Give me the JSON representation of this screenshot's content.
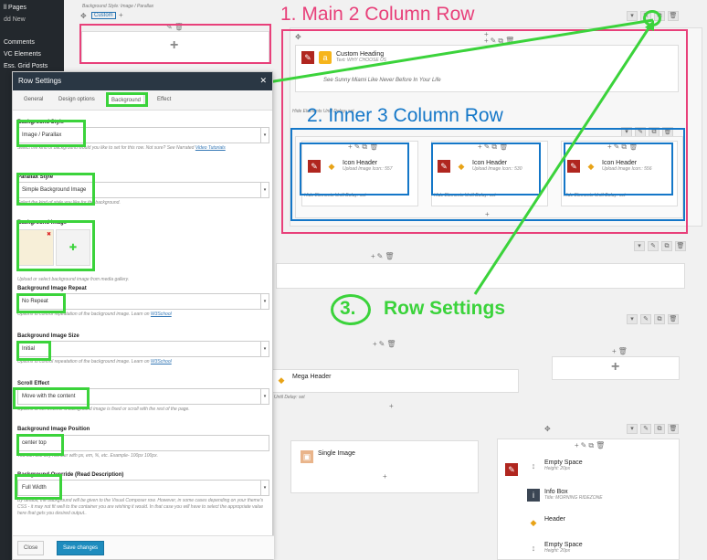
{
  "wp_menu": [
    "ll Pages",
    "dd New",
    "Comments",
    "VC Elements",
    "Ess. Grid Posts"
  ],
  "builder": {
    "top_note": "Background Style: Image / Parallax",
    "custom_tab": "Custom",
    "heading_title": "Custom Heading",
    "heading_sub": "Text: WHY CHOOSE US",
    "heading_text": "See Sunny Miami Like Never Before In Your Life",
    "hide_note": "Hide Elements Until Delay: set",
    "hide_note_short": "Until Delay: set",
    "icon_title": "Icon Header",
    "icons": [
      "Upload Image Icon:: 557",
      "Upload Image Icon:: 530",
      "Upload Image Icon:: 556"
    ],
    "mega_header": "Mega Header",
    "single_image": "Single Image",
    "right_items": [
      {
        "title": "Empty Space",
        "sub": "Height: 20px"
      },
      {
        "title": "Info Box",
        "sub": "Title: MORNING RIDEZONE"
      },
      {
        "title": "Header",
        "sub": ""
      },
      {
        "title": "Empty Space",
        "sub": "Height: 20px"
      }
    ]
  },
  "annotations": {
    "a1": "1. Main 2 Column Row",
    "a2": "2. Inner 3 Column Row",
    "a3_num": "3.",
    "a3": "Row Settings",
    "colors": {
      "pink": "#e8407a",
      "blue": "#1477c8",
      "green": "#3bd33b"
    }
  },
  "modal": {
    "title": "Row Settings",
    "tabs": [
      "General",
      "Design options",
      "Background",
      "Effect"
    ],
    "bg_style_label": "Background Style",
    "bg_style_value": "Image / Parallax",
    "bg_style_desc": "Select the kind of background would you like to set for this row. Not sure? See Narrated",
    "bg_style_link": "Video Tutorials",
    "parallax_label": "Parallax Style",
    "parallax_value": "Simple Background Image",
    "parallax_desc": "Select the kind of style you like for the background.",
    "bg_image_label": "Background Image",
    "bg_image_desc": "Upload or select background image from media gallery.",
    "repeat_label": "Background Image Repeat",
    "repeat_value": "No Repeat",
    "repeat_desc": "Options to control repeatation of the background image. Learn on",
    "repeat_link": "W3School",
    "size_label": "Background Image Size",
    "size_value": "Initial",
    "size_desc": "Options to control repeatation of the background image. Learn on",
    "size_link": "W3School",
    "scroll_label": "Scroll Effect",
    "scroll_value": "Move with the content",
    "scroll_desc": "Options to set whether a background image is fixed or scroll with the rest of the page.",
    "pos_label": "Background Image Position",
    "pos_value": "center top",
    "pos_desc": "You can use any number with px, em, %, etc. Example- 100px 100px.",
    "override_label": "Background Override (Read Description)",
    "override_value": "Full Width",
    "override_desc": "By default, the background will be given to the Visual Composer row. However, in some cases depending on your theme's CSS - it may not fit well to the container you are wishing it would. In that case you will have to select the appropriate value here that gets you desired output..",
    "close_label": "Close",
    "save_label": "Save changes"
  }
}
